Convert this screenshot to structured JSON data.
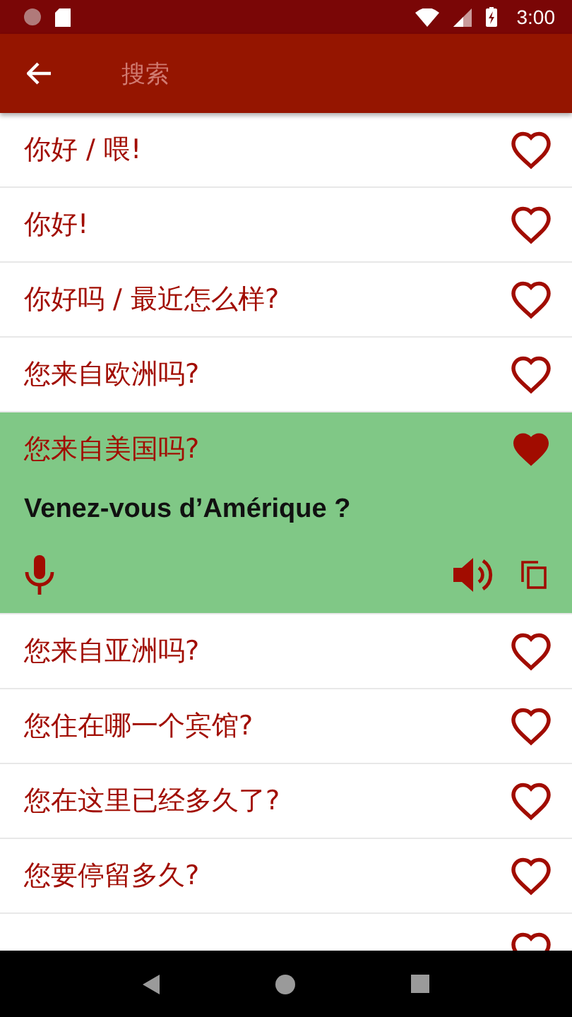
{
  "status_bar": {
    "time": "3:00"
  },
  "toolbar": {
    "search": {
      "placeholder": "搜索"
    }
  },
  "phrases": [
    {
      "text": "你好 / 喂!",
      "favorite": false,
      "expanded": false
    },
    {
      "text": "你好!",
      "favorite": false,
      "expanded": false
    },
    {
      "text": "你好吗 / 最近怎么样?",
      "favorite": false,
      "expanded": false
    },
    {
      "text": "您来自欧洲吗?",
      "favorite": false,
      "expanded": false
    },
    {
      "text": "您来自美国吗?",
      "favorite": true,
      "expanded": true,
      "translation": "Venez-vous d’Amérique ?"
    },
    {
      "text": "您来自亚洲吗?",
      "favorite": false,
      "expanded": false
    },
    {
      "text": "您住在哪一个宾馆?",
      "favorite": false,
      "expanded": false
    },
    {
      "text": "您在这里已经多久了?",
      "favorite": false,
      "expanded": false
    },
    {
      "text": "您要停留多久?",
      "favorite": false,
      "expanded": false
    },
    {
      "favorite": false,
      "expanded": false
    }
  ]
}
